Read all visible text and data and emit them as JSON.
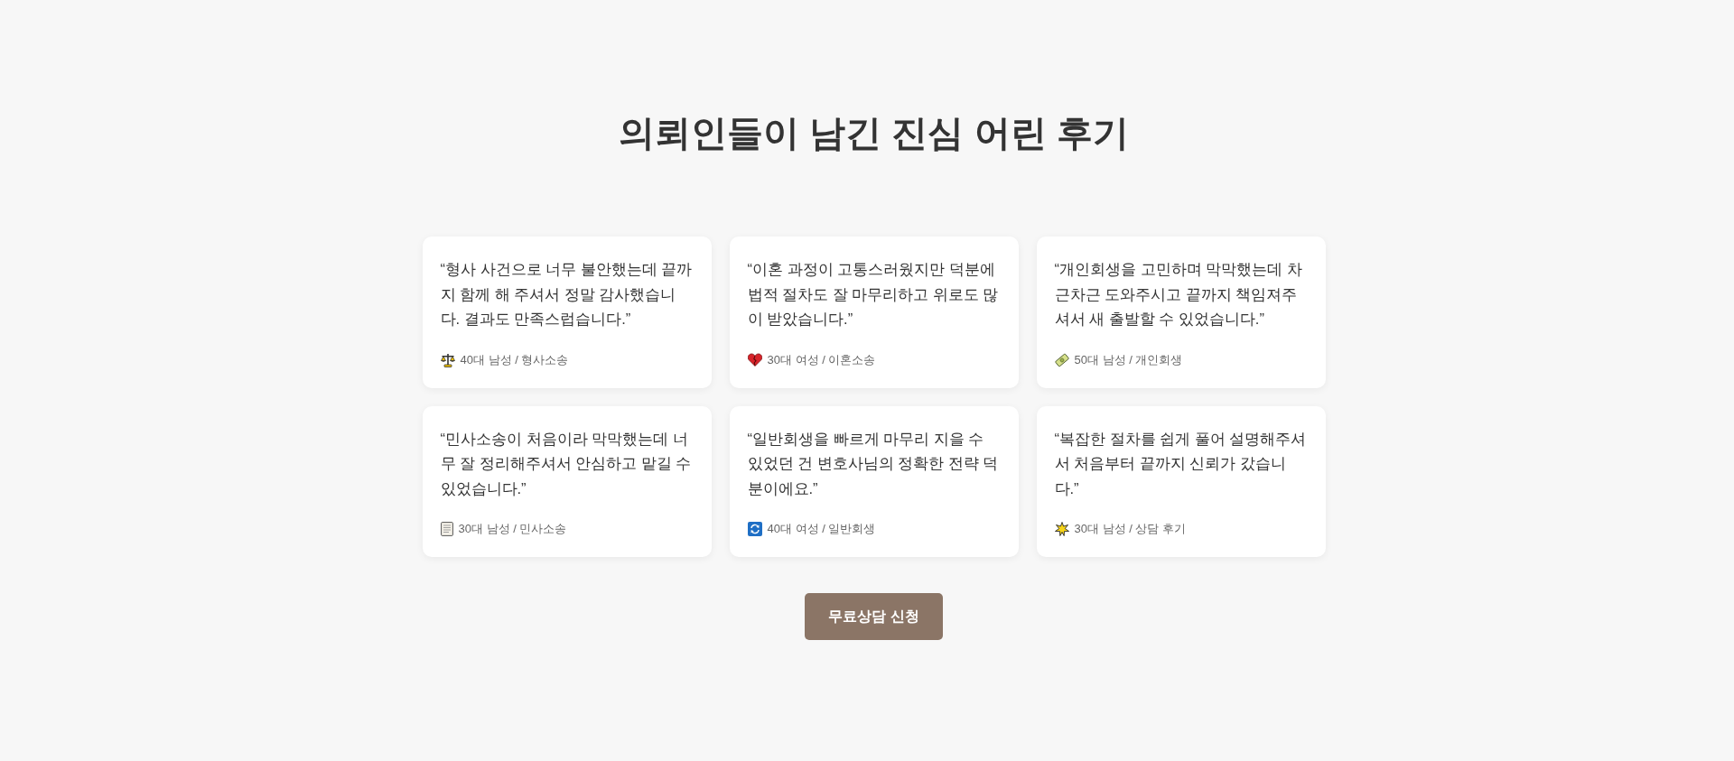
{
  "heading": "의뢰인들이 남긴 진심 어린 후기",
  "reviews": [
    {
      "kind": "scales",
      "quote": "“형사 사건으로 너무 불안했는데 끝까지 함께 해 주셔서 정말 감사했습니다. 결과도 만족스럽습니다.”",
      "author": "40대 남성 / 형사소송"
    },
    {
      "kind": "heart",
      "quote": "“이혼 과정이 고통스러웠지만 덕분에 법적 절차도 잘 마무리하고 위로도 많이 받았습니다.”",
      "author": "30대 여성 / 이혼소송"
    },
    {
      "kind": "banknote",
      "quote": "“개인회생을 고민하며 막막했는데 차근차근 도와주시고 끝까지 책임져주셔서 새 출발할 수 있었습니다.”",
      "author": "50대 남성 / 개인회생"
    },
    {
      "kind": "document",
      "quote": "“민사소송이 처음이라 막막했는데 너무 잘 정리해주셔서 안심하고 맡길 수 있었습니다.”",
      "author": "30대 남성 / 민사소송"
    },
    {
      "kind": "arrows",
      "quote": "“일반회생을 빠르게 마무리 지을 수 있었던 건 변호사님의 정확한 전략 덕분이에요.”",
      "author": "40대 여성 / 일반회생"
    },
    {
      "kind": "star",
      "quote": "“복잡한 절차를 쉽게 풀어 설명해주셔서 처음부터 끝까지 신뢰가 갔습니다.”",
      "author": "30대 남성 / 상담 후기"
    }
  ],
  "cta_button": "무료상담 신청"
}
